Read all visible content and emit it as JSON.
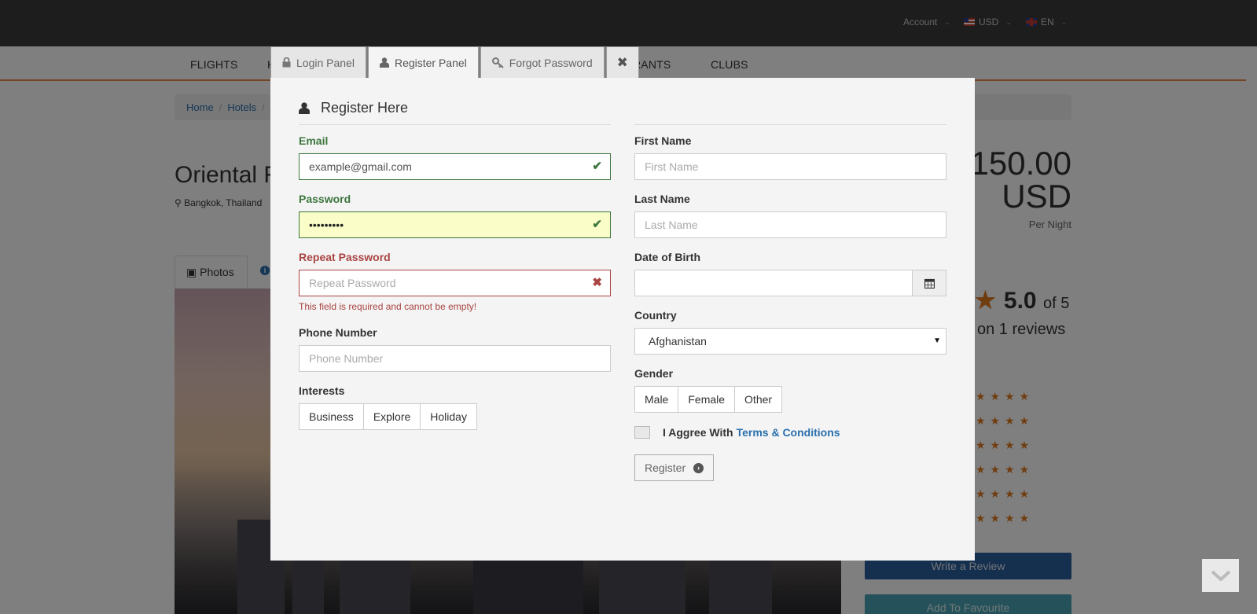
{
  "topbar": {
    "account": "Account",
    "currency": "USD",
    "language": "EN"
  },
  "nav": {
    "flights": "FLIGHTS",
    "partial_h": "H",
    "partial_rants": "RANTS",
    "clubs": "CLUBS"
  },
  "breadcrumb": {
    "home": "Home",
    "hotels": "Hotels"
  },
  "hotel": {
    "title_partial": "Oriental R",
    "location": "Bangkok, Thailand",
    "price_line1": "150.00",
    "price_line2": "USD",
    "per_night": "Per Night",
    "photos_tab": "Photos",
    "rating_value": "5.0",
    "rating_of": "of 5",
    "reviews_text": "on 1 reviews",
    "star_rows": [
      "★★★★",
      "★★★★",
      "★★★★",
      "★★★★",
      "★★★★",
      "★★★★"
    ],
    "write_review": "Write a Review",
    "add_favourite": "Add To Favourite"
  },
  "modal": {
    "tabs": {
      "login": "Login Panel",
      "register": "Register Panel",
      "forgot": "Forgot Password",
      "close": "✖"
    },
    "title": "Register Here",
    "email": {
      "label": "Email",
      "value": "example@gmail.com"
    },
    "password": {
      "label": "Password",
      "value": "•••••••••"
    },
    "repeat_password": {
      "label": "Repeat Password",
      "placeholder": "Repeat Password",
      "error": "This field is required and cannot be empty!"
    },
    "phone": {
      "label": "Phone Number",
      "placeholder": "Phone Number"
    },
    "interests": {
      "label": "Interests",
      "options": [
        "Business",
        "Explore",
        "Holiday"
      ]
    },
    "first_name": {
      "label": "First Name",
      "placeholder": "First Name"
    },
    "last_name": {
      "label": "Last Name",
      "placeholder": "Last Name"
    },
    "dob": {
      "label": "Date of Birth",
      "value": ""
    },
    "country": {
      "label": "Country",
      "selected": "Afghanistan"
    },
    "gender": {
      "label": "Gender",
      "options": [
        "Male",
        "Female",
        "Other"
      ]
    },
    "agree": {
      "text": "I Aggree With",
      "link": "Terms & Conditions"
    },
    "register_button": "Register"
  },
  "colors": {
    "success": "#3c763d",
    "error": "#a94442",
    "link": "#2a6fad",
    "accent_orange": "#e07b20",
    "topbar": "#3a3a3a"
  },
  "icons": {
    "lock": "lock-icon",
    "user": "user-icon",
    "key": "key-icon",
    "close": "close-icon",
    "check": "check-icon",
    "cross": "cross-icon",
    "calendar": "calendar-icon",
    "chevron": "chevron-down-icon"
  }
}
